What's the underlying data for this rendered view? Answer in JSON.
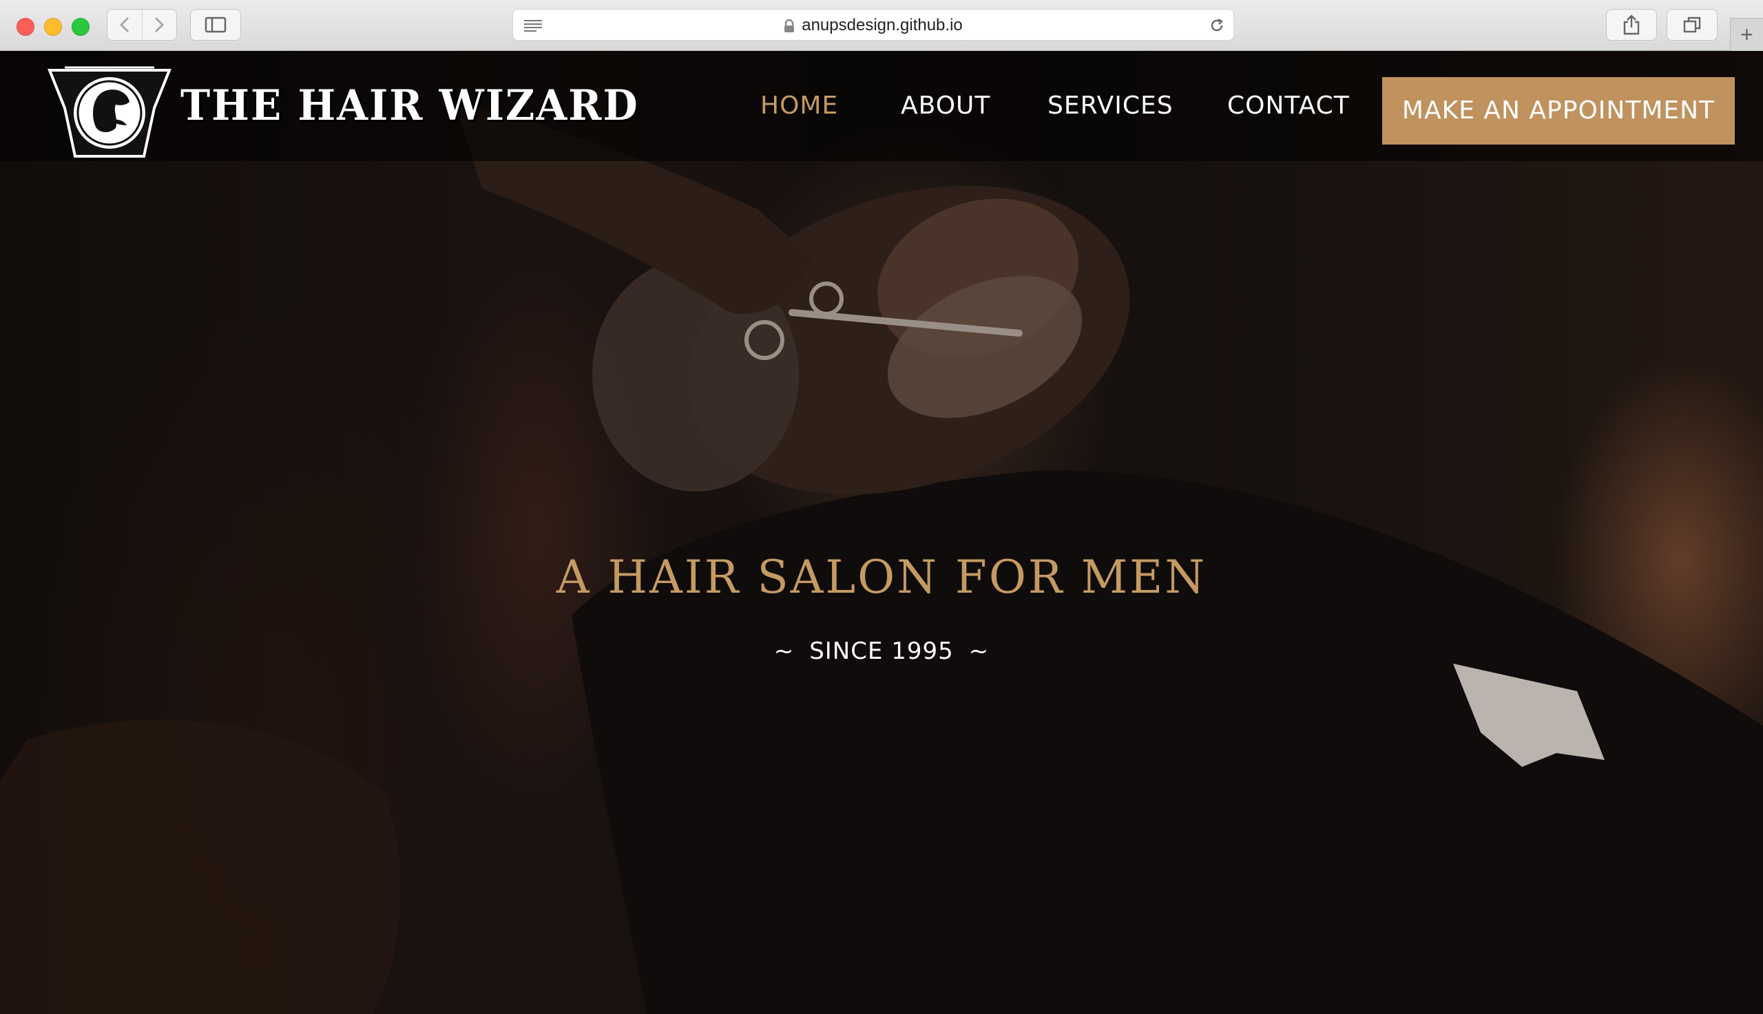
{
  "browser": {
    "url": "anupsdesign.github.io"
  },
  "site": {
    "brand_name": "THE HAIR WIZARD",
    "nav": [
      {
        "label": "HOME",
        "active": true
      },
      {
        "label": "ABOUT",
        "active": false
      },
      {
        "label": "SERVICES",
        "active": false
      },
      {
        "label": "CONTACT",
        "active": false
      }
    ],
    "cta_label": "MAKE AN APPOINTMENT",
    "accent_color": "#c59a62",
    "cta_color": "#c0925e"
  },
  "hero": {
    "title": "A HAIR SALON FOR MEN",
    "since_prefix": "~",
    "since_text": "SINCE 1995",
    "since_suffix": "~"
  },
  "icons": [
    "back-icon",
    "forward-icon",
    "sidebar-icon",
    "reader-icon",
    "lock-icon",
    "reload-icon",
    "share-icon",
    "tabs-icon",
    "plus-icon",
    "barber-logo-icon"
  ]
}
